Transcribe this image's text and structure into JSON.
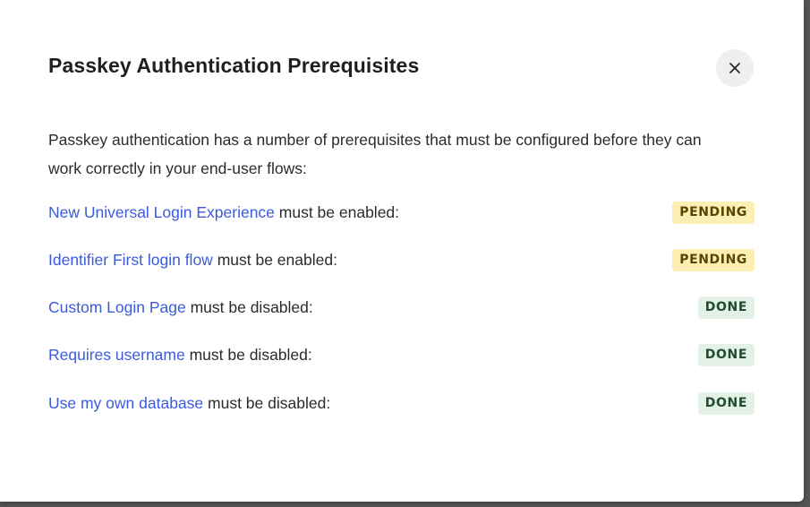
{
  "modal": {
    "title": "Passkey Authentication Prerequisites",
    "close_icon": "close-icon",
    "description": "Passkey authentication has a number of prerequisites that must be configured before they can work correctly in your end-user flows:"
  },
  "prerequisites": [
    {
      "link": "New Universal Login Experience",
      "text": " must be enabled:",
      "status": "PENDING"
    },
    {
      "link": "Identifier First login flow",
      "text": " must be enabled:",
      "status": "PENDING"
    },
    {
      "link": "Custom Login Page",
      "text": " must be disabled:",
      "status": "DONE"
    },
    {
      "link": "Requires username",
      "text": " must be disabled:",
      "status": "DONE"
    },
    {
      "link": "Use my own database",
      "text": " must be disabled:",
      "status": "DONE"
    }
  ],
  "colors": {
    "link": "#3b5bdb",
    "pending_bg": "#fbefb3",
    "done_bg": "#e3f1e6"
  }
}
